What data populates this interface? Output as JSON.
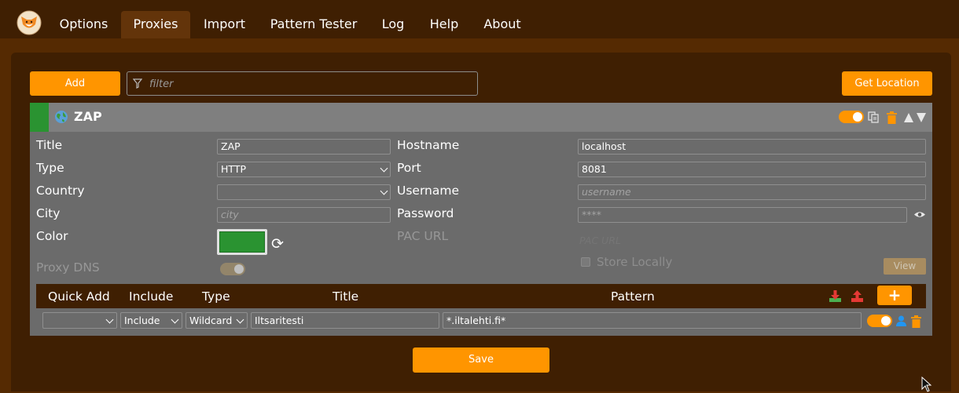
{
  "nav": {
    "tabs": [
      {
        "label": "Options",
        "active": false
      },
      {
        "label": "Proxies",
        "active": true
      },
      {
        "label": "Import",
        "active": false
      },
      {
        "label": "Pattern Tester",
        "active": false
      },
      {
        "label": "Log",
        "active": false
      },
      {
        "label": "Help",
        "active": false
      },
      {
        "label": "About",
        "active": false
      }
    ]
  },
  "toolbar": {
    "add_label": "Add",
    "filter_placeholder": "filter",
    "get_location_label": "Get Location"
  },
  "proxy": {
    "title": "ZAP",
    "color": "#2a9331",
    "enabled": true,
    "labels": {
      "title": "Title",
      "type": "Type",
      "country": "Country",
      "city": "City",
      "color": "Color",
      "proxy_dns": "Proxy DNS",
      "hostname": "Hostname",
      "port": "Port",
      "username": "Username",
      "password": "Password",
      "pac_url": "PAC URL",
      "store_locally": "Store Locally"
    },
    "values": {
      "title": "ZAP",
      "type": "HTTP",
      "country": "",
      "city_placeholder": "city",
      "hostname": "localhost",
      "port": "8081",
      "username_placeholder": "username",
      "password_placeholder": "****",
      "pac_url_placeholder": "PAC URL"
    },
    "view_label": "View"
  },
  "patterns": {
    "headers": {
      "quick_add": "Quick Add",
      "include": "Include",
      "type": "Type",
      "title": "Title",
      "pattern": "Pattern"
    },
    "add_label": "+",
    "rows": [
      {
        "quick_add": "",
        "include": "Include",
        "type": "Wildcard",
        "title": "Iltsaritesti",
        "pattern": "*.iltalehti.fi*",
        "enabled": true
      }
    ]
  },
  "footer": {
    "save_label": "Save"
  },
  "colors": {
    "accent": "#ff9500",
    "nav_bg": "#3f1f02",
    "page_bg": "#552a02",
    "card_bg": "#6b6b6b"
  }
}
